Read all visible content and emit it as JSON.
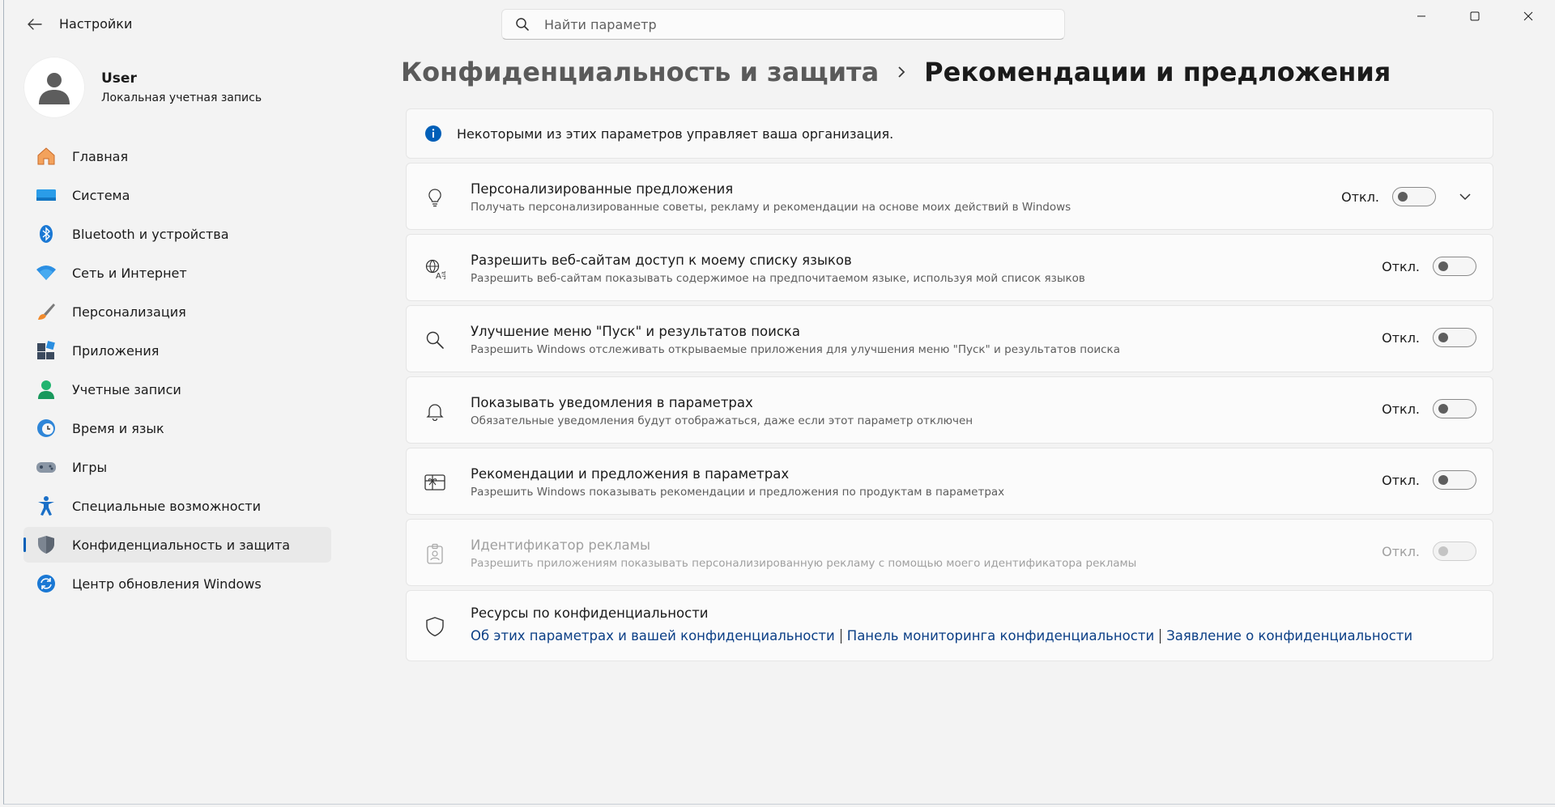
{
  "titlebar": {
    "app_title": "Настройки",
    "search_placeholder": "Найти параметр"
  },
  "user": {
    "name": "User",
    "account_type": "Локальная учетная запись"
  },
  "sidebar": {
    "items": [
      {
        "label": "Главная",
        "icon": "home-icon",
        "active": false
      },
      {
        "label": "Система",
        "icon": "system-icon",
        "active": false
      },
      {
        "label": "Bluetooth и устройства",
        "icon": "bluetooth-icon",
        "active": false
      },
      {
        "label": "Сеть и Интернет",
        "icon": "wifi-icon",
        "active": false
      },
      {
        "label": "Персонализация",
        "icon": "brush-icon",
        "active": false
      },
      {
        "label": "Приложения",
        "icon": "apps-icon",
        "active": false
      },
      {
        "label": "Учетные записи",
        "icon": "person-icon",
        "active": false
      },
      {
        "label": "Время и язык",
        "icon": "clock-globe-icon",
        "active": false
      },
      {
        "label": "Игры",
        "icon": "gamepad-icon",
        "active": false
      },
      {
        "label": "Специальные возможности",
        "icon": "accessibility-icon",
        "active": false
      },
      {
        "label": "Конфиденциальность и защита",
        "icon": "shield-icon",
        "active": true
      },
      {
        "label": "Центр обновления Windows",
        "icon": "update-icon",
        "active": false
      }
    ]
  },
  "breadcrumb": {
    "parent": "Конфиденциальность и защита",
    "current": "Рекомендации и предложения"
  },
  "info_banner": {
    "text": "Некоторыми из этих параметров управляет ваша организация."
  },
  "settings": [
    {
      "title": "Персонализированные предложения",
      "description": "Получать персонализированные советы, рекламу и рекомендации на основе моих действий в Windows",
      "state": "Откл.",
      "icon": "lightbulb-icon"
    },
    {
      "title": "Разрешить веб-сайтам доступ к моему списку языков",
      "description": "Разрешить веб-сайтам показывать содержимое на предпочитаемом языке, используя мой список языков",
      "state": "Откл.",
      "icon": "language-icon"
    },
    {
      "title": "Улучшение меню \"Пуск\" и результатов поиска",
      "description": "Разрешить Windows отслеживать открываемые приложения для улучшения меню \"Пуск\" и результатов поиска",
      "state": "Откл.",
      "icon": "search-icon"
    },
    {
      "title": "Показывать уведомления в параметрах",
      "description": "Обязательные уведомления будут отображаться, даже если этот параметр отключен",
      "state": "Откл.",
      "icon": "bell-icon"
    },
    {
      "title": "Рекомендации и предложения в параметрах",
      "description": "Разрешить Windows показывать рекомендации и предложения по продуктам в параметрах",
      "state": "Откл.",
      "icon": "gift-card-icon"
    },
    {
      "title": "Идентификатор рекламы",
      "description": "Разрешить приложениям показывать персонализированную рекламу с помощью моего идентификатора рекламы",
      "state": "Откл.",
      "icon": "id-badge-icon",
      "disabled": true
    }
  ],
  "resources": {
    "title": "Ресурсы по конфиденциальности",
    "links": [
      "Об этих параметрах и вашей конфиденциальности",
      "Панель мониторинга конфиденциальности",
      "Заявление о конфиденциальности"
    ]
  },
  "colors": {
    "accent": "#005fb8",
    "link": "#0b3f86",
    "background": "#f3f3f3",
    "card": "#fbfbfb"
  }
}
